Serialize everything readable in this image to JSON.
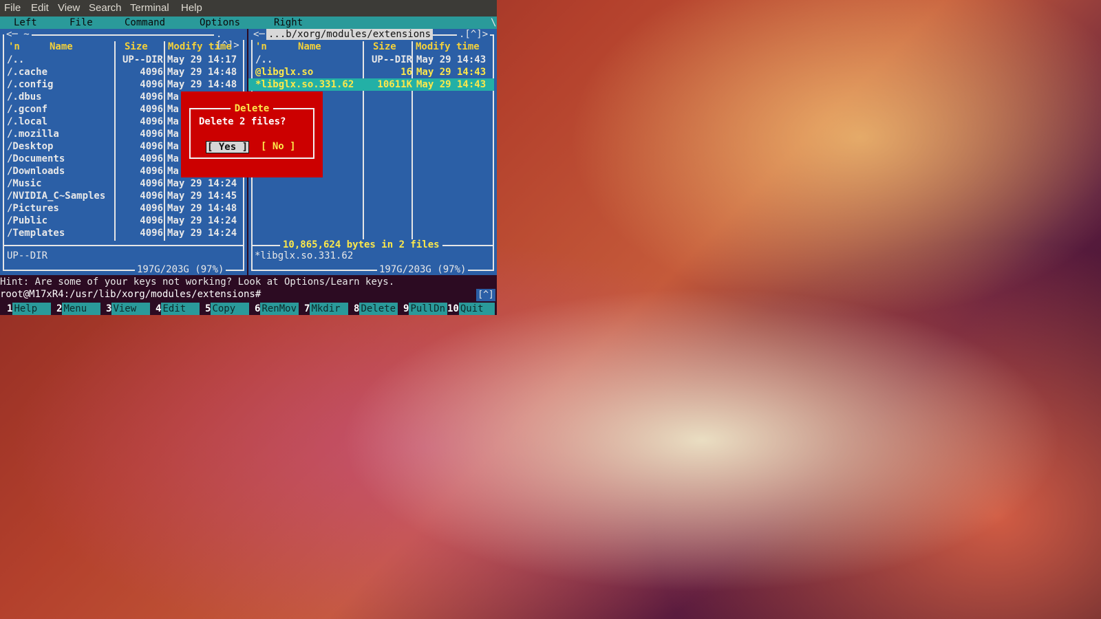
{
  "app_menu": [
    "File",
    "Edit",
    "View",
    "Search",
    "Terminal",
    "Help"
  ],
  "mc_menu": [
    "Left",
    "File",
    "Command",
    "Options",
    "Right"
  ],
  "mc_menu_edge": "\\",
  "left_panel": {
    "path_left": "<─ ~ ",
    "path_right": ".[^]>",
    "headers": {
      "sort": "'n",
      "name": "Name",
      "size": "Size",
      "mtime": "Modify time"
    },
    "rows": [
      {
        "name": "/..",
        "size": "UP--DIR",
        "mtime": "May 29 14:17"
      },
      {
        "name": "/.cache",
        "size": "4096",
        "mtime": "May 29 14:48"
      },
      {
        "name": "/.config",
        "size": "4096",
        "mtime": "May 29 14:48"
      },
      {
        "name": "/.dbus",
        "size": "4096",
        "mtime": "Ma"
      },
      {
        "name": "/.gconf",
        "size": "4096",
        "mtime": "Ma"
      },
      {
        "name": "/.local",
        "size": "4096",
        "mtime": "Ma"
      },
      {
        "name": "/.mozilla",
        "size": "4096",
        "mtime": "Ma"
      },
      {
        "name": "/Desktop",
        "size": "4096",
        "mtime": "Ma"
      },
      {
        "name": "/Documents",
        "size": "4096",
        "mtime": "Ma"
      },
      {
        "name": "/Downloads",
        "size": "4096",
        "mtime": "Ma"
      },
      {
        "name": "/Music",
        "size": "4096",
        "mtime": "May 29 14:24"
      },
      {
        "name": "/NVIDIA_C~Samples",
        "size": "4096",
        "mtime": "May 29 14:45"
      },
      {
        "name": "/Pictures",
        "size": "4096",
        "mtime": "May 29 14:48"
      },
      {
        "name": "/Public",
        "size": "4096",
        "mtime": "May 29 14:24"
      },
      {
        "name": "/Templates",
        "size": "4096",
        "mtime": "May 29 14:24"
      }
    ],
    "status": "UP--DIR",
    "disk": "197G/203G (97%)"
  },
  "right_panel": {
    "path_left": "<─",
    "path": " ...b/xorg/modules/extensions ",
    "path_right": ".[^]>",
    "headers": {
      "sort": "'n",
      "name": "Name",
      "size": "Size",
      "mtime": "Modify time"
    },
    "rows": [
      {
        "name": "/..",
        "size": "UP--DIR",
        "mtime": "May 29 14:43"
      },
      {
        "name": "@libglx.so",
        "size": "16",
        "mtime": "May 29 14:43"
      },
      {
        "name": "*libglx.so.331.62",
        "size": "10611K",
        "mtime": "May 29 14:43"
      }
    ],
    "bytes_info": "10,865,624 bytes in 2 files",
    "status": "*libglx.so.331.62",
    "disk": "197G/203G (97%)"
  },
  "dialog": {
    "title": "Delete",
    "message": "Delete 2 files?",
    "yes_label": "[ Yes ]",
    "no_label": "[ No ]"
  },
  "hint": "Hint: Are some of your keys not working? Look at Options/Learn keys.",
  "prompt": "root@M17xR4:/usr/lib/xorg/modules/extensions#",
  "caret_button": "[^]",
  "fkeys": [
    {
      "num": "1",
      "label": "Help"
    },
    {
      "num": "2",
      "label": "Menu"
    },
    {
      "num": "3",
      "label": "View"
    },
    {
      "num": "4",
      "label": "Edit"
    },
    {
      "num": "5",
      "label": "Copy"
    },
    {
      "num": "6",
      "label": "RenMov"
    },
    {
      "num": "7",
      "label": "Mkdir"
    },
    {
      "num": "8",
      "label": "Delete"
    },
    {
      "num": "9",
      "label": "PullDn"
    },
    {
      "num": "10",
      "label": "Quit"
    }
  ]
}
